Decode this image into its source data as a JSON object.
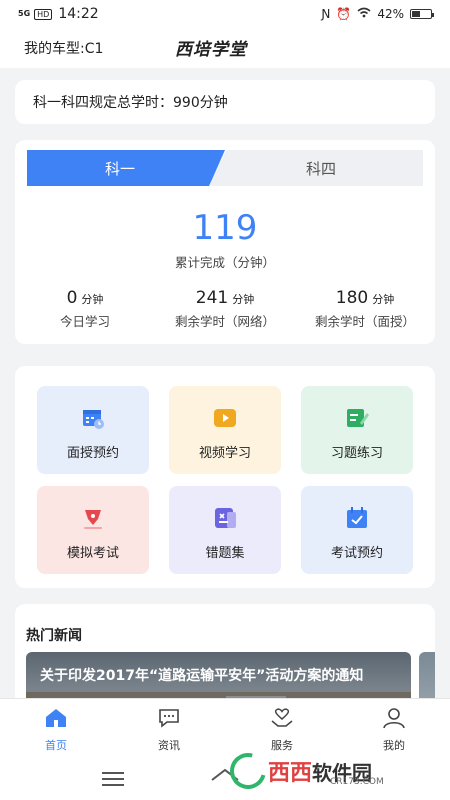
{
  "status_bar": {
    "signal": "5G",
    "hd": "HD",
    "time": "14:22",
    "battery": "42%",
    "battery_level": 0.42
  },
  "header": {
    "car_model": "我的车型:C1",
    "logo_text": "西培学堂"
  },
  "total_hours": {
    "text": "科一科四规定总学时：990分钟"
  },
  "study": {
    "tabs": [
      {
        "label": "科一",
        "active": true
      },
      {
        "label": "科四",
        "active": false
      }
    ],
    "completed_value": "119",
    "completed_label": "累计完成（分钟）",
    "stats": [
      {
        "value": "0",
        "unit": "分钟",
        "label": "今日学习"
      },
      {
        "value": "241",
        "unit": "分钟",
        "label": "剩余学时（网络）"
      },
      {
        "value": "180",
        "unit": "分钟",
        "label": "剩余学时（面授）"
      }
    ]
  },
  "features": [
    {
      "label": "面授预约",
      "icon": "calendar-clock-icon",
      "bg": "#e6eefc",
      "color": "#3f82f5"
    },
    {
      "label": "视频学习",
      "icon": "video-play-icon",
      "bg": "#fdf3df",
      "color": "#f0a820"
    },
    {
      "label": "习题练习",
      "icon": "edit-note-icon",
      "bg": "#e3f4ea",
      "color": "#2fae63"
    },
    {
      "label": "模拟考试",
      "icon": "pen-nib-icon",
      "bg": "#fce6e4",
      "color": "#e5484d"
    },
    {
      "label": "错题集",
      "icon": "mistake-book-icon",
      "bg": "#ecebfb",
      "color": "#6c63e0"
    },
    {
      "label": "考试预约",
      "icon": "calendar-check-icon",
      "bg": "#e6eefc",
      "color": "#3f82f5"
    }
  ],
  "news": {
    "section_title": "热门新闻",
    "headline": "关于印发2017年“道路运输平安年”活动方案的通知"
  },
  "tabbar": [
    {
      "label": "首页",
      "icon": "home-icon",
      "active": true
    },
    {
      "label": "资讯",
      "icon": "chat-bubble-icon",
      "active": false
    },
    {
      "label": "服务",
      "icon": "heart-hand-icon",
      "active": false
    },
    {
      "label": "我的",
      "icon": "user-icon",
      "active": false
    }
  ],
  "watermark": {
    "part1": "西西",
    "part2": "软件园",
    "sub": "CR173.COM"
  },
  "colors": {
    "accent": "#3f82f5",
    "background": "#f2f3f5"
  }
}
